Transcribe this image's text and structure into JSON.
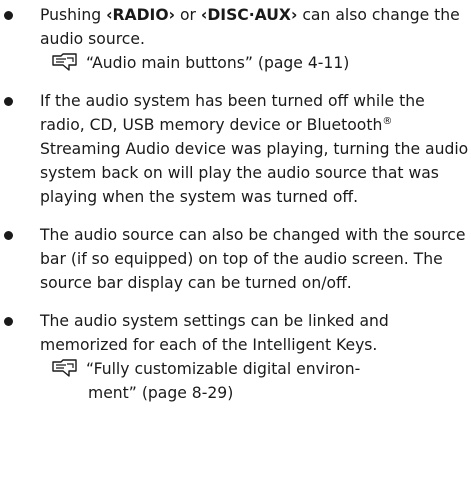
{
  "items": [
    {
      "text_before": "Pushing ",
      "btn1": "‹RADIO›",
      "text_mid": " or ",
      "btn2": "‹DISC·AUX›",
      "text_after": " can also change the audio source.",
      "ref": "“Audio main buttons” (page 4-11)"
    },
    {
      "text_a": "If the audio system has been turned off while the radio, CD, USB memory device or Bluetooth",
      "reg": "®",
      "text_b": " Streaming Audio device was playing, turning the audio system back on will play the audio source that was playing when the system was turned off."
    },
    {
      "text": "The audio source can also be changed with the source bar (if so equipped) on top of the audio screen. The source bar display can be turned on/off."
    },
    {
      "text": "The audio system settings can be linked and memorized for each of the Intelligent Keys.",
      "ref_line1": "“Fully customizable digital environ-",
      "ref_line2": "ment” (page 8-29)"
    }
  ],
  "icons": {
    "reference": "reference-pointer-icon"
  }
}
